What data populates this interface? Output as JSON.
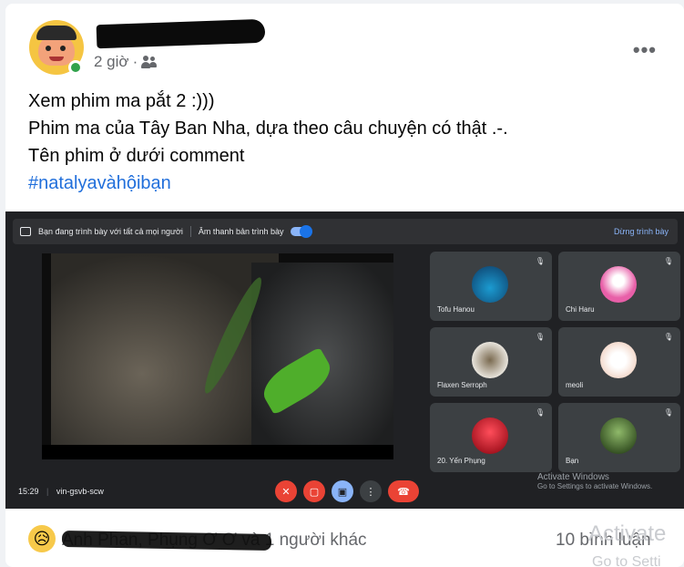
{
  "post": {
    "time": "2 giờ",
    "separator": "·",
    "more_label": "•••",
    "lines": [
      "Xem phim ma pắt 2 :)))",
      "Phim ma của Tây Ban Nha, dựa theo câu chuyện có thật .-.",
      "Tên phim ở dưới comment"
    ],
    "hashtag": "#natalyavàhộibạn"
  },
  "meet": {
    "banner_text": "Bạn đang trình bày với tất cả mọi người",
    "audio_label": "Âm thanh bản trình bày",
    "stop_label": "Dừng trình bày",
    "time": "15:29",
    "separator": "|",
    "meeting_code": "vin-gsvb-scw",
    "participants": [
      {
        "name": "Tofu Hanou",
        "color": "#2e7bb8"
      },
      {
        "name": "Chi Haru",
        "color": "#e85fa8"
      },
      {
        "name": "Flaxen Serroph",
        "color": "#d8d0c0"
      },
      {
        "name": "meoli",
        "color": "#f1e3d7"
      },
      {
        "name": "20. Yến Phụng",
        "color": "#d21f2b"
      },
      {
        "name": "Bạn",
        "color": "#5b7b3a"
      }
    ],
    "activate_title": "Activate Windows",
    "activate_sub": "Go to Settings to activate Windows."
  },
  "footer": {
    "reaction_icon": "sad-face-icon",
    "reactions_text": "Anh Phan, Phụng Ơ Ơ và 1 người khác",
    "comments": "10 bình luận",
    "watermark_title": "Activate",
    "watermark_sub": "Go to Setti"
  },
  "colors": {
    "hashtag": "#216fdb",
    "online": "#31a24c",
    "end_call": "#ea4335",
    "meet_bg": "#202124"
  }
}
